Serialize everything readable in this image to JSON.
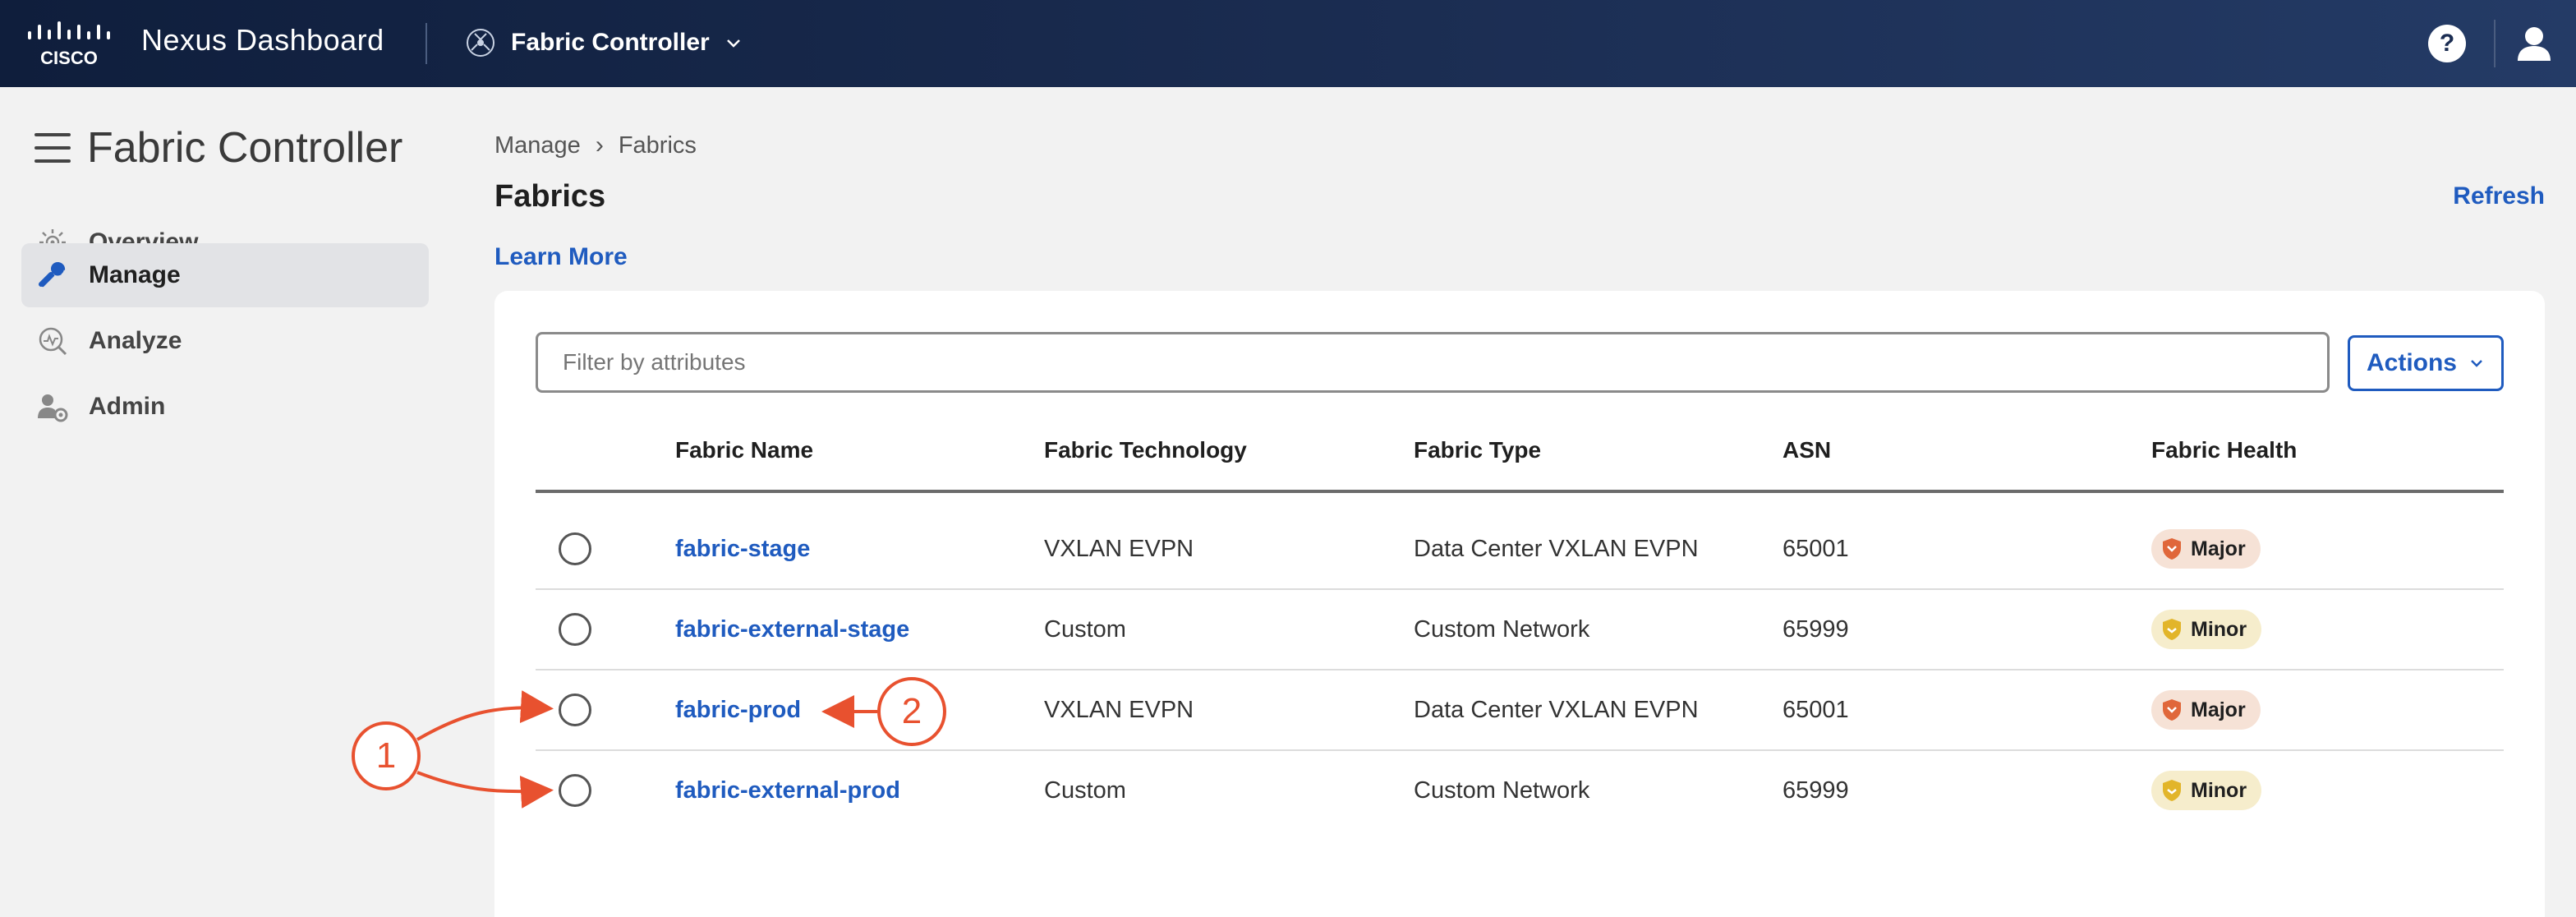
{
  "header": {
    "product_name": "Nexus Dashboard",
    "app_name": "Fabric Controller",
    "help_label": "?"
  },
  "sidebar": {
    "title": "Fabric Controller",
    "items": [
      {
        "label": "Overview",
        "icon": "overview-icon"
      },
      {
        "label": "Manage",
        "icon": "wrench-icon",
        "active": true
      },
      {
        "label": "Analyze",
        "icon": "analyze-icon"
      },
      {
        "label": "Admin",
        "icon": "admin-icon"
      }
    ]
  },
  "breadcrumb": {
    "items": [
      "Manage",
      "Fabrics"
    ],
    "separator": "›"
  },
  "page": {
    "title": "Fabrics",
    "refresh_label": "Refresh",
    "learn_more_label": "Learn More"
  },
  "filter": {
    "placeholder": "Filter by attributes",
    "value": ""
  },
  "actions": {
    "label": "Actions"
  },
  "table": {
    "columns": [
      "Fabric Name",
      "Fabric Technology",
      "Fabric Type",
      "ASN",
      "Fabric Health"
    ],
    "rows": [
      {
        "name": "fabric-stage",
        "technology": "VXLAN EVPN",
        "type": "Data Center VXLAN EVPN",
        "asn": "65001",
        "health": "Major"
      },
      {
        "name": "fabric-external-stage",
        "technology": "Custom",
        "type": "Custom Network",
        "asn": "65999",
        "health": "Minor"
      },
      {
        "name": "fabric-prod",
        "technology": "VXLAN EVPN",
        "type": "Data Center VXLAN EVPN",
        "asn": "65001",
        "health": "Major"
      },
      {
        "name": "fabric-external-prod",
        "technology": "Custom",
        "type": "Custom Network",
        "asn": "65999",
        "health": "Minor"
      }
    ]
  },
  "annotations": {
    "callout_1": "1",
    "callout_2": "2"
  },
  "colors": {
    "accent": "#1f5bbf",
    "major": "#e0673a",
    "minor": "#e2b52a",
    "annotation": "#e8512f"
  }
}
